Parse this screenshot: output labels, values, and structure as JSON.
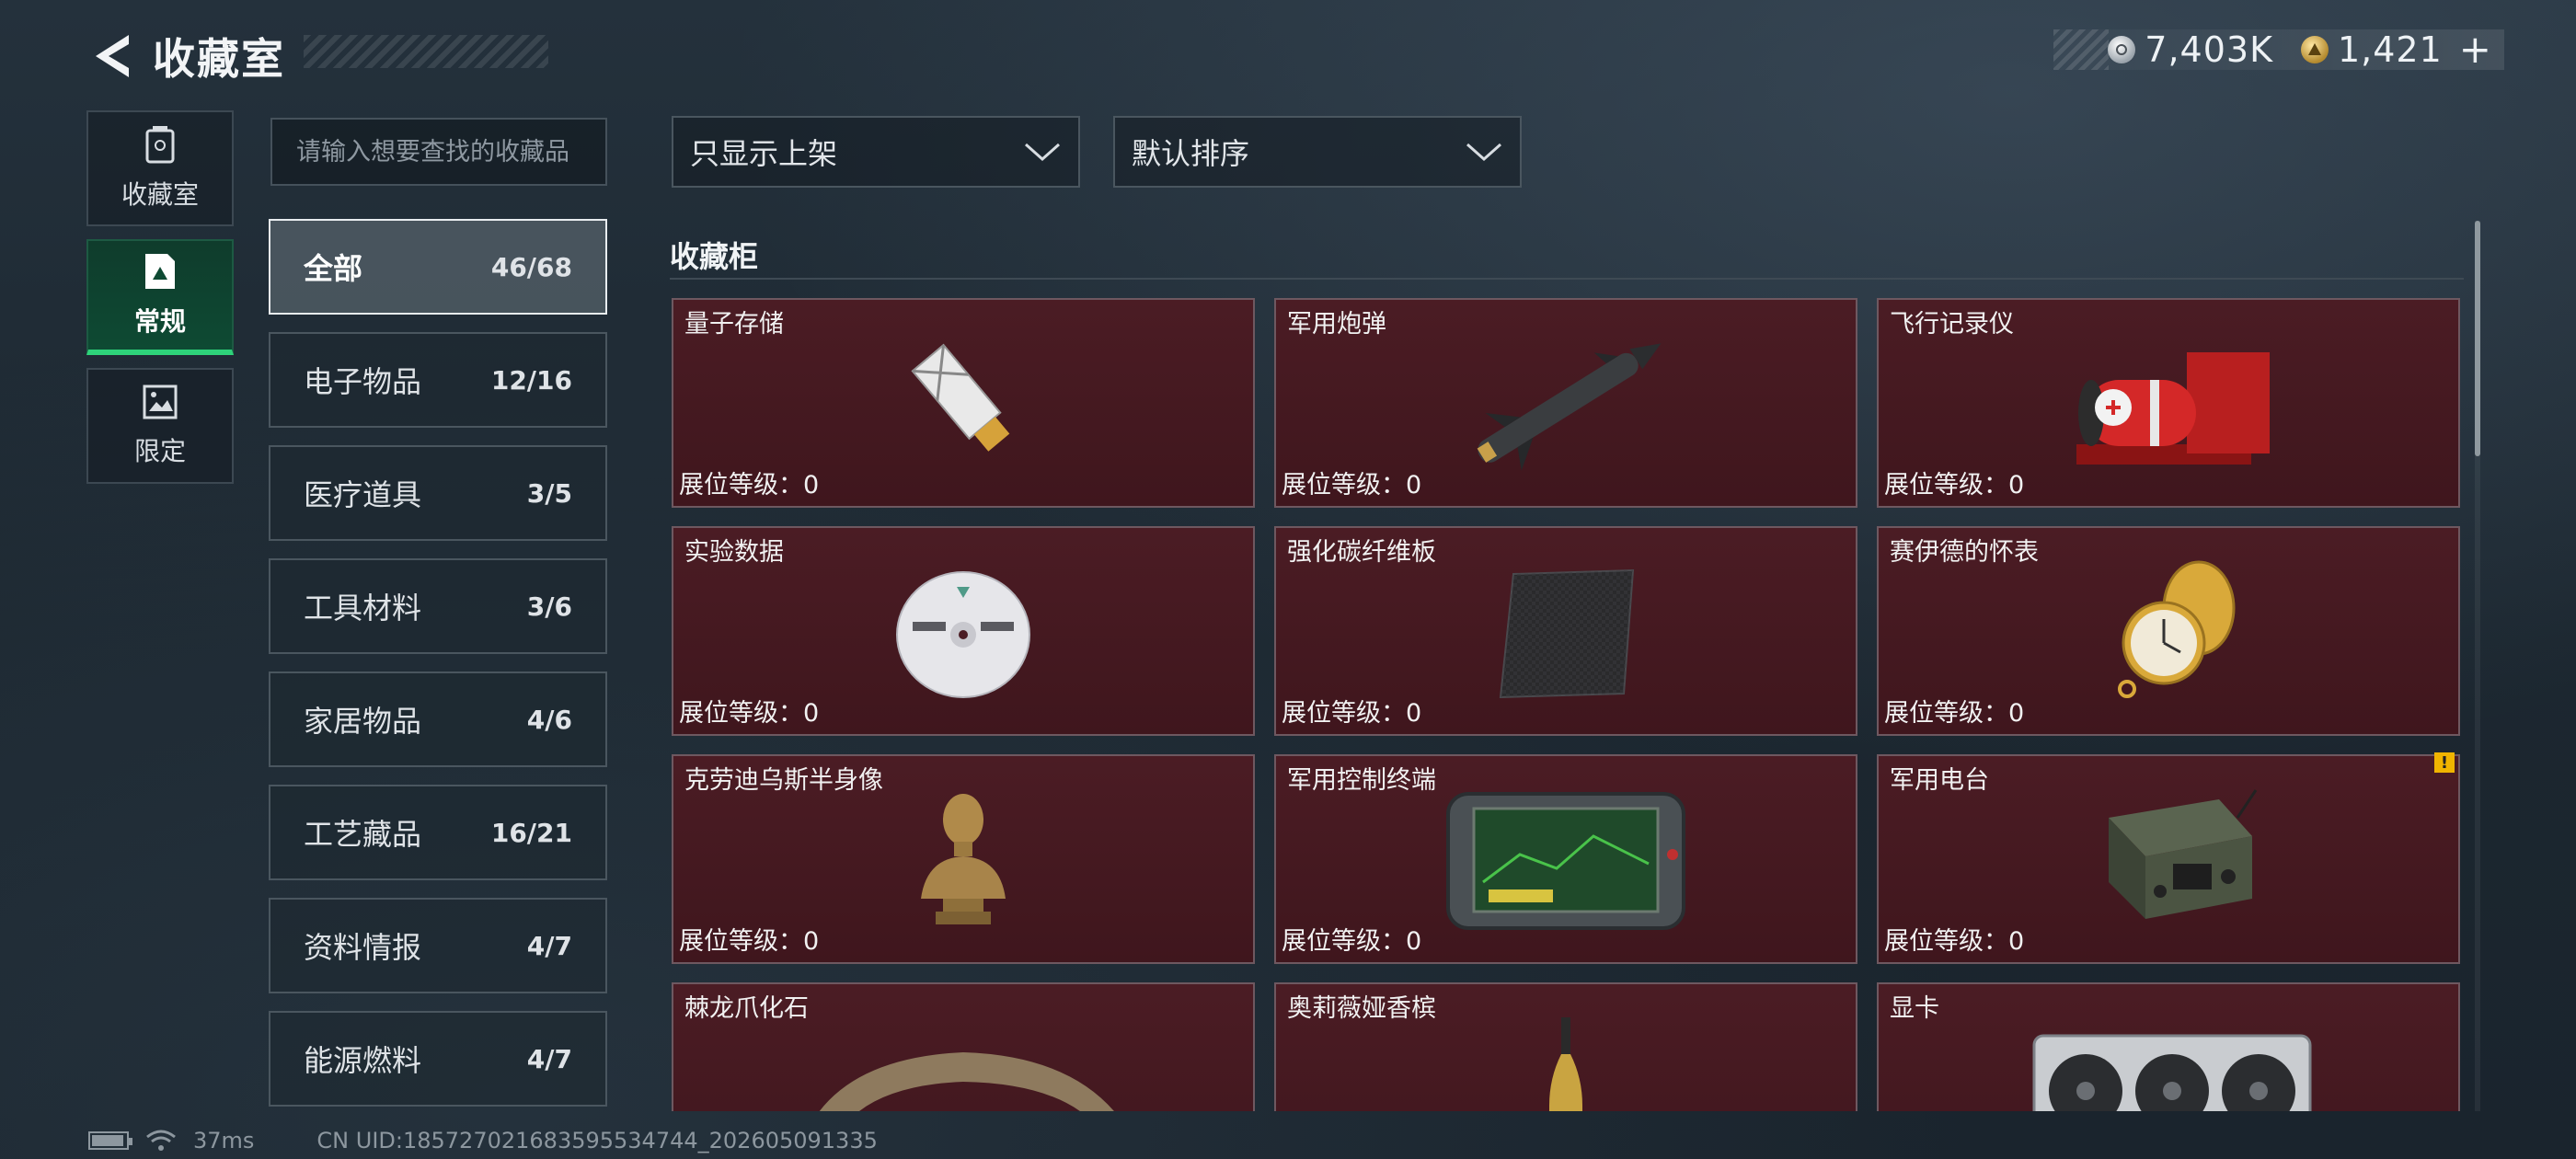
{
  "header": {
    "title": "收藏室",
    "currency_silver": "7,403K",
    "currency_gold": "1,421"
  },
  "left_nav": [
    {
      "label": "收藏室",
      "icon": "trash-can-icon",
      "active": false
    },
    {
      "label": "常规",
      "icon": "document-icon",
      "active": true
    },
    {
      "label": "限定",
      "icon": "picture-icon",
      "active": false
    }
  ],
  "search": {
    "placeholder": "请输入想要查找的收藏品",
    "value": ""
  },
  "categories": [
    {
      "name": "全部",
      "count": "46/68",
      "active": true
    },
    {
      "name": "电子物品",
      "count": "12/16",
      "active": false
    },
    {
      "name": "医疗道具",
      "count": "3/5",
      "active": false
    },
    {
      "name": "工具材料",
      "count": "3/6",
      "active": false
    },
    {
      "name": "家居物品",
      "count": "4/6",
      "active": false
    },
    {
      "name": "工艺藏品",
      "count": "16/21",
      "active": false
    },
    {
      "name": "资料情报",
      "count": "4/7",
      "active": false
    },
    {
      "name": "能源燃料",
      "count": "4/7",
      "active": false
    }
  ],
  "filters": {
    "display_filter": "只显示上架",
    "sort_order": "默认排序"
  },
  "cabinet": {
    "title": "收藏柜",
    "level_label": "展位等级：0",
    "items": [
      {
        "name": "量子存储",
        "icon": "usb-drive-icon"
      },
      {
        "name": "军用炮弹",
        "icon": "missile-icon"
      },
      {
        "name": "飞行记录仪",
        "icon": "flight-recorder-icon"
      },
      {
        "name": "实验数据",
        "icon": "disc-icon"
      },
      {
        "name": "强化碳纤维板",
        "icon": "carbon-plate-icon"
      },
      {
        "name": "赛伊德的怀表",
        "icon": "pocket-watch-icon"
      },
      {
        "name": "克劳迪乌斯半身像",
        "icon": "bust-icon"
      },
      {
        "name": "军用控制终端",
        "icon": "control-terminal-icon"
      },
      {
        "name": "军用电台",
        "icon": "radio-icon",
        "warning": "!"
      },
      {
        "name": "棘龙爪化石",
        "icon": "claw-fossil-icon"
      },
      {
        "name": "奥莉薇娅香槟",
        "icon": "champagne-icon"
      },
      {
        "name": "显卡",
        "icon": "graphics-card-icon"
      }
    ]
  },
  "footer": {
    "ping": "37ms",
    "uid": "CN UID:185727021683595534744_202605091335"
  },
  "colors": {
    "card_bg": "#4b1c24",
    "active_nav": "#0e4a33",
    "active_accent": "#2ed37a",
    "warning": "#f0b400"
  }
}
